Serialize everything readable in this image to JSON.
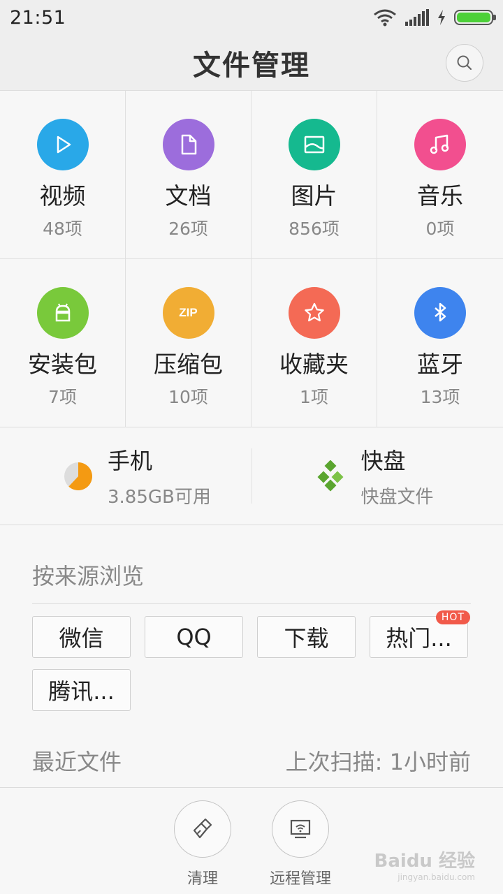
{
  "status_bar": {
    "time": "21:51"
  },
  "header": {
    "title": "文件管理"
  },
  "categories": [
    {
      "name": "视频",
      "count": "48项",
      "color": "#29a8e8",
      "icon": "play-icon"
    },
    {
      "name": "文档",
      "count": "26项",
      "color": "#9c6ddc",
      "icon": "document-icon"
    },
    {
      "name": "图片",
      "count": "856项",
      "color": "#15b98f",
      "icon": "image-icon"
    },
    {
      "name": "音乐",
      "count": "0项",
      "color": "#f24f8f",
      "icon": "music-icon"
    },
    {
      "name": "安装包",
      "count": "7项",
      "color": "#79c93b",
      "icon": "android-icon"
    },
    {
      "name": "压缩包",
      "count": "10项",
      "color": "#f1ad34",
      "icon": "zip-icon"
    },
    {
      "name": "收藏夹",
      "count": "1项",
      "color": "#f46a55",
      "icon": "star-icon"
    },
    {
      "name": "蓝牙",
      "count": "13项",
      "color": "#3e84ee",
      "icon": "bluetooth-icon"
    }
  ],
  "zip_text": "ZIP",
  "storage": {
    "phone": {
      "title": "手机",
      "sub": "3.85GB可用",
      "used_fraction": 0.62
    },
    "kuaipan": {
      "title": "快盘",
      "sub": "快盘文件"
    }
  },
  "browse": {
    "title": "按来源浏览",
    "sources": [
      "微信",
      "QQ",
      "下载",
      "热门...",
      "腾讯..."
    ],
    "hot_badge": "HOT"
  },
  "recent": {
    "title": "最近文件",
    "last_scan": "上次扫描: 1小时前"
  },
  "bottom_tools": [
    {
      "label": "清理",
      "icon": "broom-icon"
    },
    {
      "label": "远程管理",
      "icon": "remote-pc-icon"
    }
  ],
  "watermark": {
    "text": "Baidu 经验",
    "sub": "jingyan.baidu.com"
  }
}
